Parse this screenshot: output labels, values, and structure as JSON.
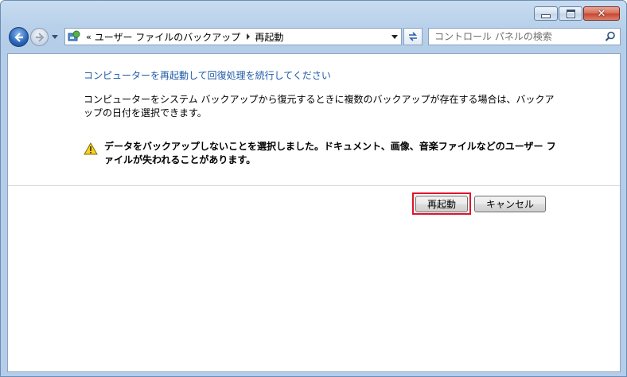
{
  "window": {
    "caption_buttons": [
      "minimize",
      "maximize",
      "close"
    ]
  },
  "nav": {
    "address": {
      "overflow": "«",
      "crumbs": [
        "ユーザー ファイルのバックアップ",
        "再起動"
      ]
    },
    "search": {
      "placeholder": "コントロール パネルの検索"
    }
  },
  "content": {
    "heading": "コンピューターを再起動して回復処理を続行してください",
    "description": "コンピューターをシステム バックアップから復元するときに複数のバックアップが存在する場合は、バックアップの日付を選択できます。",
    "warning": "データをバックアップしないことを選択しました。ドキュメント、画像、音楽ファイルなどのユーザー ファイルが失われることがあります。",
    "buttons": {
      "restart": "再起動",
      "cancel": "キャンセル"
    }
  },
  "colors": {
    "heading": "#1e5aa8",
    "highlight": "#e0142a"
  },
  "icons": [
    "back-arrow-icon",
    "forward-arrow-icon",
    "control-panel-icon",
    "refresh-icon",
    "search-icon",
    "warning-icon"
  ]
}
